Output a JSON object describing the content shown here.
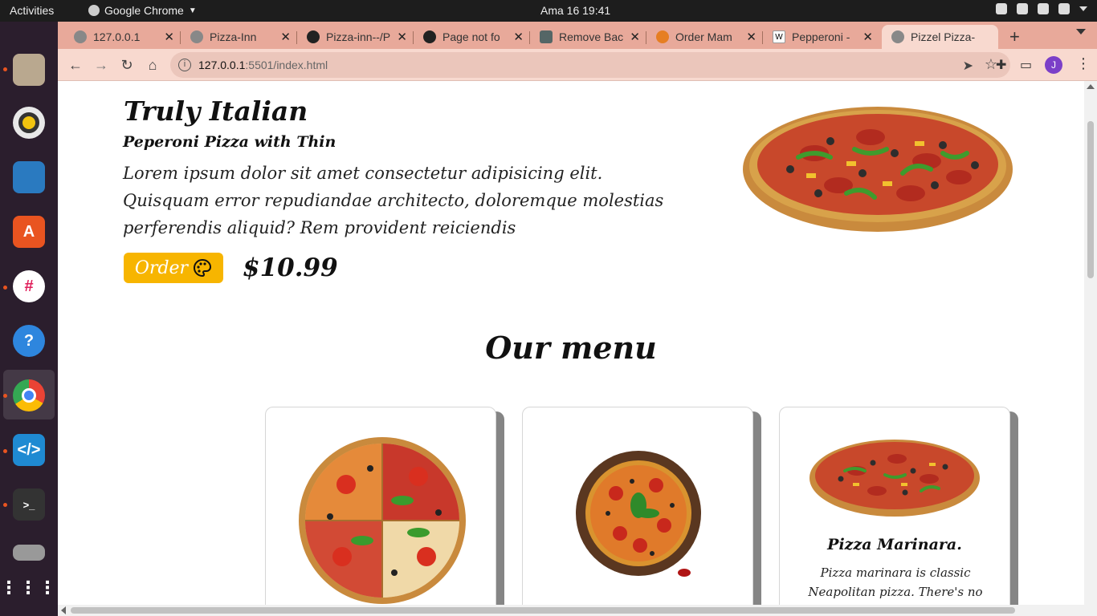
{
  "system": {
    "activities": "Activities",
    "app_name": "Google Chrome",
    "clock": "Ama 16  19:41"
  },
  "tabs": [
    {
      "title": "127.0.0.1",
      "favicon": "globe-icon"
    },
    {
      "title": "Pizza-Inn",
      "favicon": "globe-icon"
    },
    {
      "title": "Pizza-inn--/P",
      "favicon": "github-icon"
    },
    {
      "title": "Page not fo",
      "favicon": "github-icon"
    },
    {
      "title": "Remove Bac",
      "favicon": "removebg-icon"
    },
    {
      "title": "Order Mam",
      "favicon": "pizza-icon"
    },
    {
      "title": "Pepperoni -",
      "favicon": "wikipedia-icon"
    },
    {
      "title": "Pizzel Pizza-",
      "favicon": "globe-icon"
    }
  ],
  "address_bar": {
    "host": "127.0.0.1",
    "path": ":5501/index.html"
  },
  "profile_initial": "J",
  "hero": {
    "title": "Truly Italian",
    "subtitle": "Peperoni Pizza with Thin",
    "description": "Lorem ipsum dolor sit amet consectetur adipisicing elit. Quisquam error repudiandae architecto, doloremque molestias perferendis aliquid? Rem provident reiciendis",
    "order_label": "Order",
    "price": "$10.99"
  },
  "menu": {
    "title": "Our menu",
    "cards": [
      {
        "name": "",
        "description": ""
      },
      {
        "name": "",
        "description": ""
      },
      {
        "name": "Pizza Marinara.",
        "description": "Pizza marinara is classic Neapolitan pizza. There's no"
      }
    ]
  },
  "colors": {
    "accent": "#f7b500",
    "tabstrip": "#e8a99a",
    "toolbar": "#f8d9cf"
  }
}
